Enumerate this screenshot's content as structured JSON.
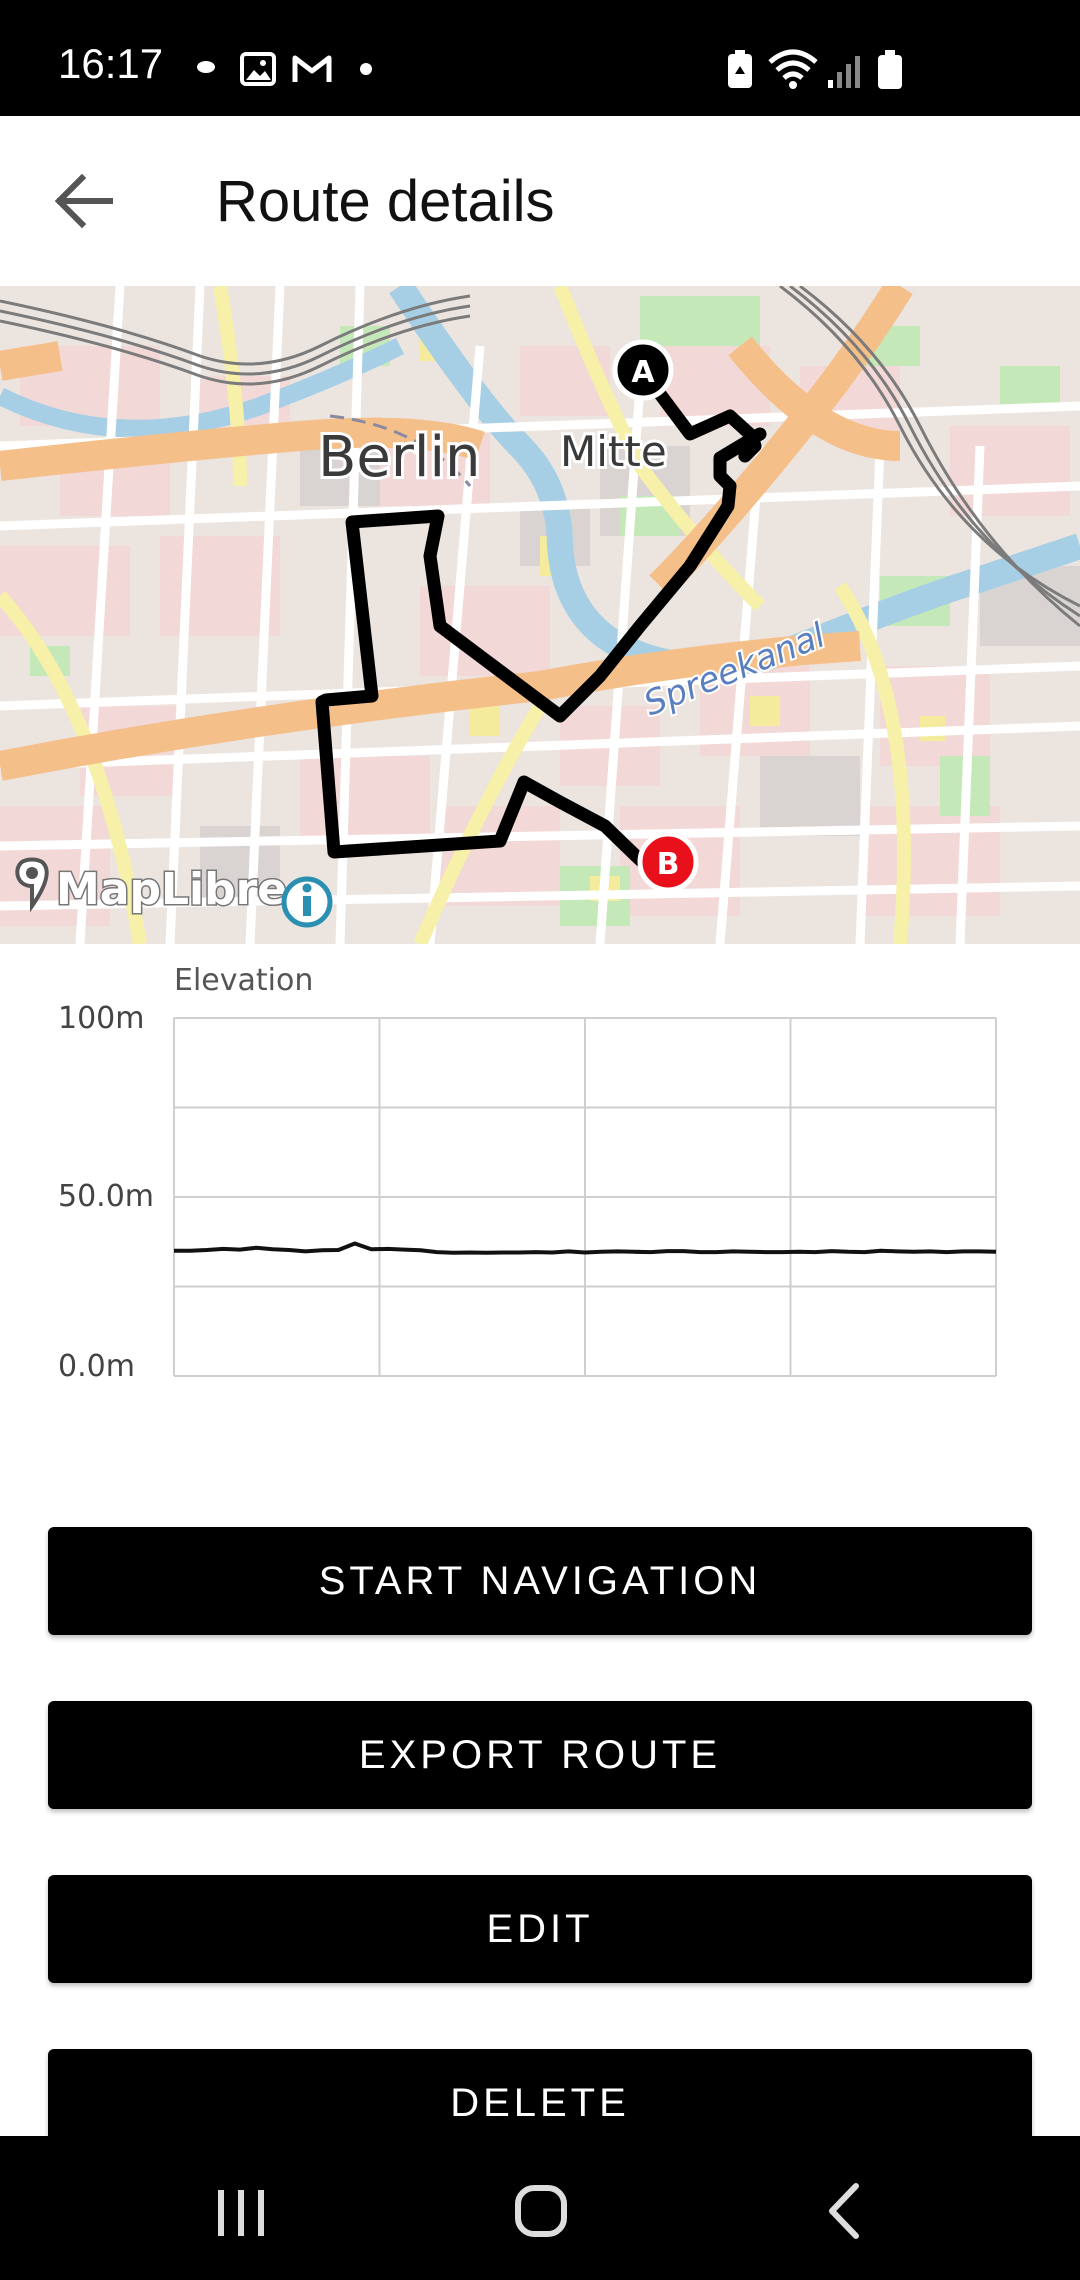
{
  "status_bar": {
    "time": "16:17",
    "left_icons": [
      "cloud-icon",
      "image-icon",
      "gmail-icon",
      "dot-icon"
    ],
    "right_icons": [
      "battery-saver-icon",
      "wifi-icon",
      "signal-icon",
      "battery-icon"
    ]
  },
  "app_bar": {
    "back_icon": "arrow-back-icon",
    "title": "Route details"
  },
  "map": {
    "labels": {
      "city": "Berlin",
      "district": "Mitte",
      "river": "Spreekanal"
    },
    "marker_start": "A",
    "marker_end": "B",
    "attribution": "MapLibre",
    "colors": {
      "start_marker": "#000000",
      "end_marker": "#e8101a",
      "route": "#000000"
    }
  },
  "elevation_chart": {
    "title": "Elevation",
    "y_ticks": [
      "100m",
      "50.0m",
      "0.0m"
    ]
  },
  "chart_data": {
    "type": "line",
    "title": "Elevation",
    "ylabel": "",
    "xlabel": "",
    "ylim": [
      0,
      100
    ],
    "grid": true,
    "y_ticks": [
      "100m",
      "50.0m",
      "0.0m"
    ],
    "series": [
      {
        "values": [
          35,
          35,
          35.2,
          35.5,
          35.3,
          35.8,
          35.4,
          35.2,
          34.8,
          35.1,
          35.2,
          37,
          35.4,
          35.5,
          35.3,
          35.1,
          34.6,
          34.4,
          34.5,
          34.4,
          34.5,
          34.5,
          34.6,
          34.5,
          34.8,
          34.5,
          34.7,
          34.8,
          34.7,
          34.6,
          34.9,
          34.9,
          34.6,
          34.6,
          34.8,
          34.7,
          34.6,
          34.6,
          34.7,
          34.6,
          34.9,
          34.7,
          34.6,
          35,
          34.8,
          34.7,
          34.8,
          34.6,
          34.8,
          34.8,
          34.7
        ]
      }
    ]
  },
  "actions": {
    "start_navigation": "START NAVIGATION",
    "export_route": "EXPORT ROUTE",
    "edit": "EDIT",
    "delete": "DELETE"
  },
  "nav_bar": {
    "icons": [
      "recent-apps-icon",
      "home-icon",
      "back-icon"
    ]
  }
}
